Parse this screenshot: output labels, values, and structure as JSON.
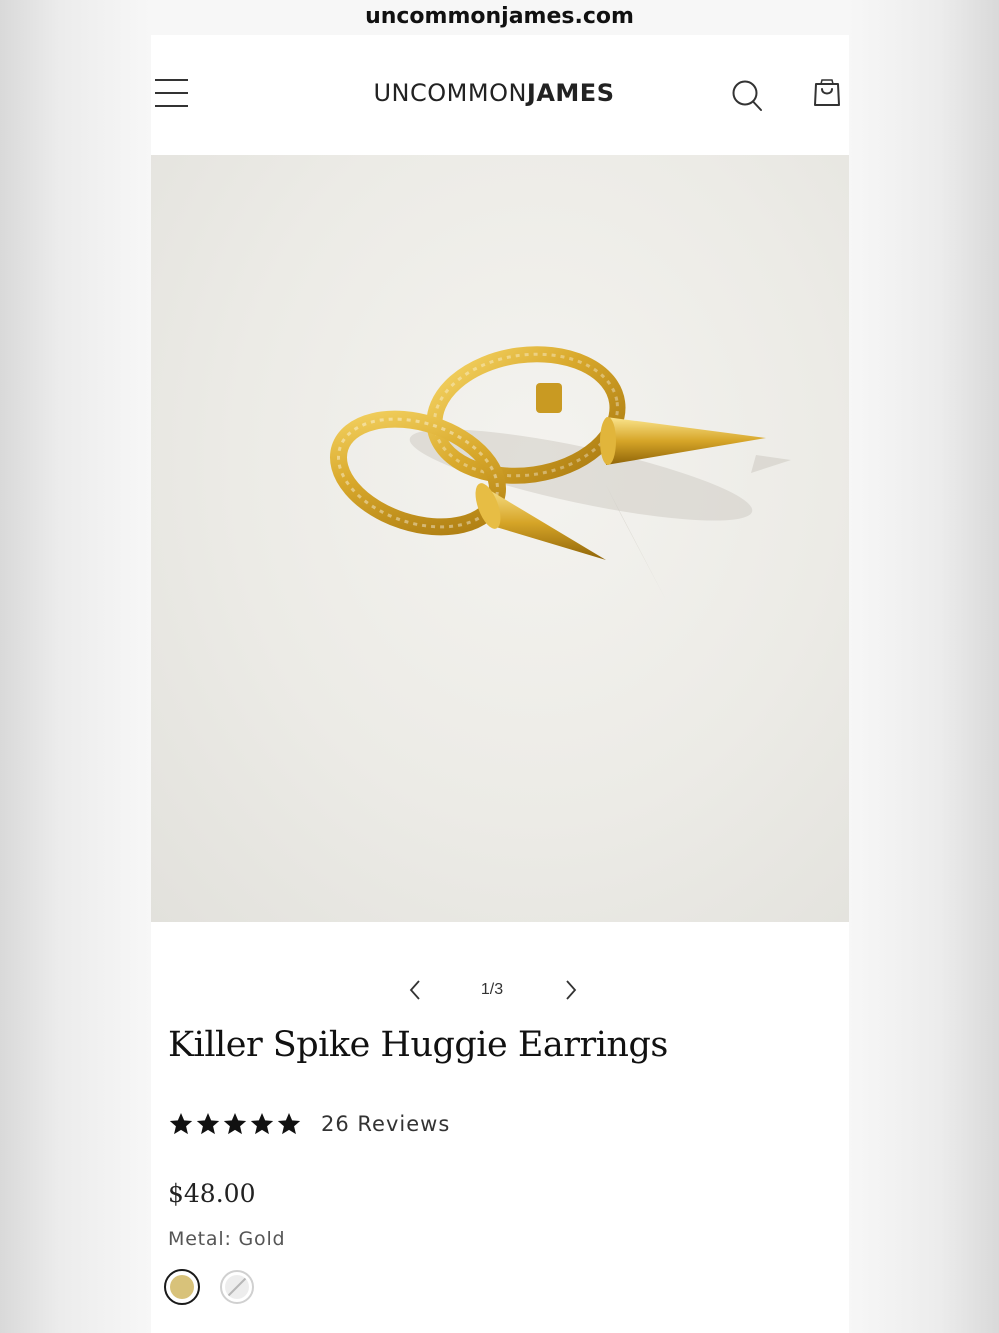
{
  "browser": {
    "url": "uncommonjames.com"
  },
  "header": {
    "logo_light": "UNCOMMON",
    "logo_bold": "JAMES"
  },
  "gallery": {
    "counter": "1/3"
  },
  "product": {
    "title": "Killer Spike Huggie Earrings",
    "rating_stars": 5,
    "reviews": "26 Reviews",
    "price": "$48.00",
    "metal_label": "Metal: Gold",
    "swatches": [
      {
        "name": "Gold",
        "color": "#d8c27a",
        "selected": true
      },
      {
        "name": "Silver",
        "color": "#ededed",
        "selected": false
      }
    ]
  },
  "colors": {
    "gold": "#d8c27a",
    "text": "#111111",
    "background": "#ffffff"
  }
}
